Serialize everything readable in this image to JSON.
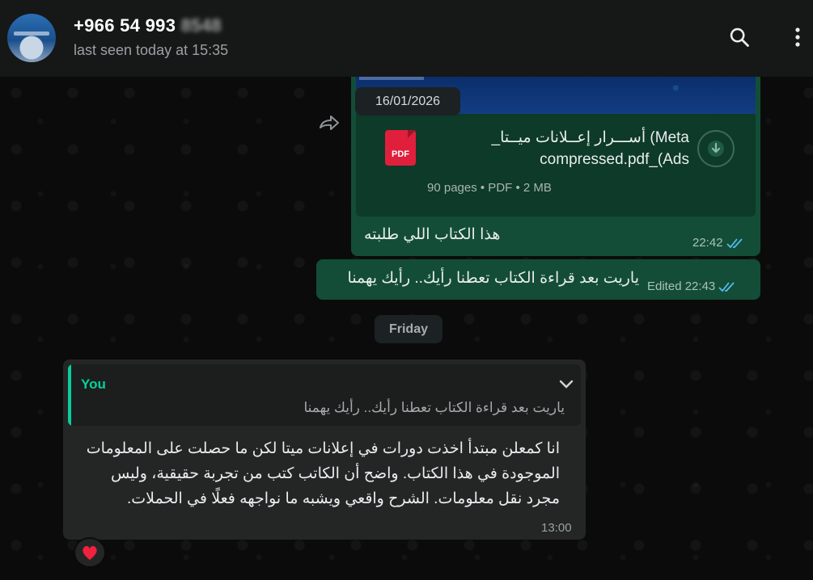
{
  "header": {
    "contact_name": "+966 54 993",
    "contact_name_hidden": "8548",
    "status": "last seen today at 15:35",
    "icons": [
      "search-icon",
      "more-vertical-icon"
    ]
  },
  "messages": {
    "document": {
      "date_chip": "16/01/2026",
      "file_title": "_أســـرار إعــلانات ميــتا (Meta Ads)_compressed.pdf",
      "file_title_line1": "_أســـرار إعــلانات ميــتا (Meta",
      "file_title_line2": "compressed.pdf_(Ads",
      "file_type_icon": "PDF",
      "meta": "90 pages • PDF • 2 MB",
      "caption": "هذا الكتاب اللي طلبته",
      "time": "22:42"
    },
    "outgoing_2": {
      "text": "ياريت بعد قراءة الكتاب تعطنا رأيك.. رأيك يهمنا",
      "edited_label": "Edited",
      "time": "22:43"
    },
    "day_separator": "Friday",
    "incoming": {
      "quote_author": "You",
      "quote_text": "ياريت بعد قراءة الكتاب تعطنا رأيك.. رأيك يهمنا",
      "text": "انا كمعلن مبتدأ اخذت دورات في إعلانات ميتا لكن ما حصلت على المعلومات الموجودة في هذا الكتاب. واضح أن الكاتب كتب من تجربة حقيقية، وليس مجرد نقل معلومات. الشرح واقعي ويشبه ما نواجهه فعلًا في الحملات.",
      "time": "13:00",
      "reaction": "❤️"
    }
  },
  "colors": {
    "outgoing_bubble": "#134d37",
    "incoming_bubble": "#242626",
    "accent": "#06cf9c",
    "read_ticks": "#53bdeb"
  }
}
